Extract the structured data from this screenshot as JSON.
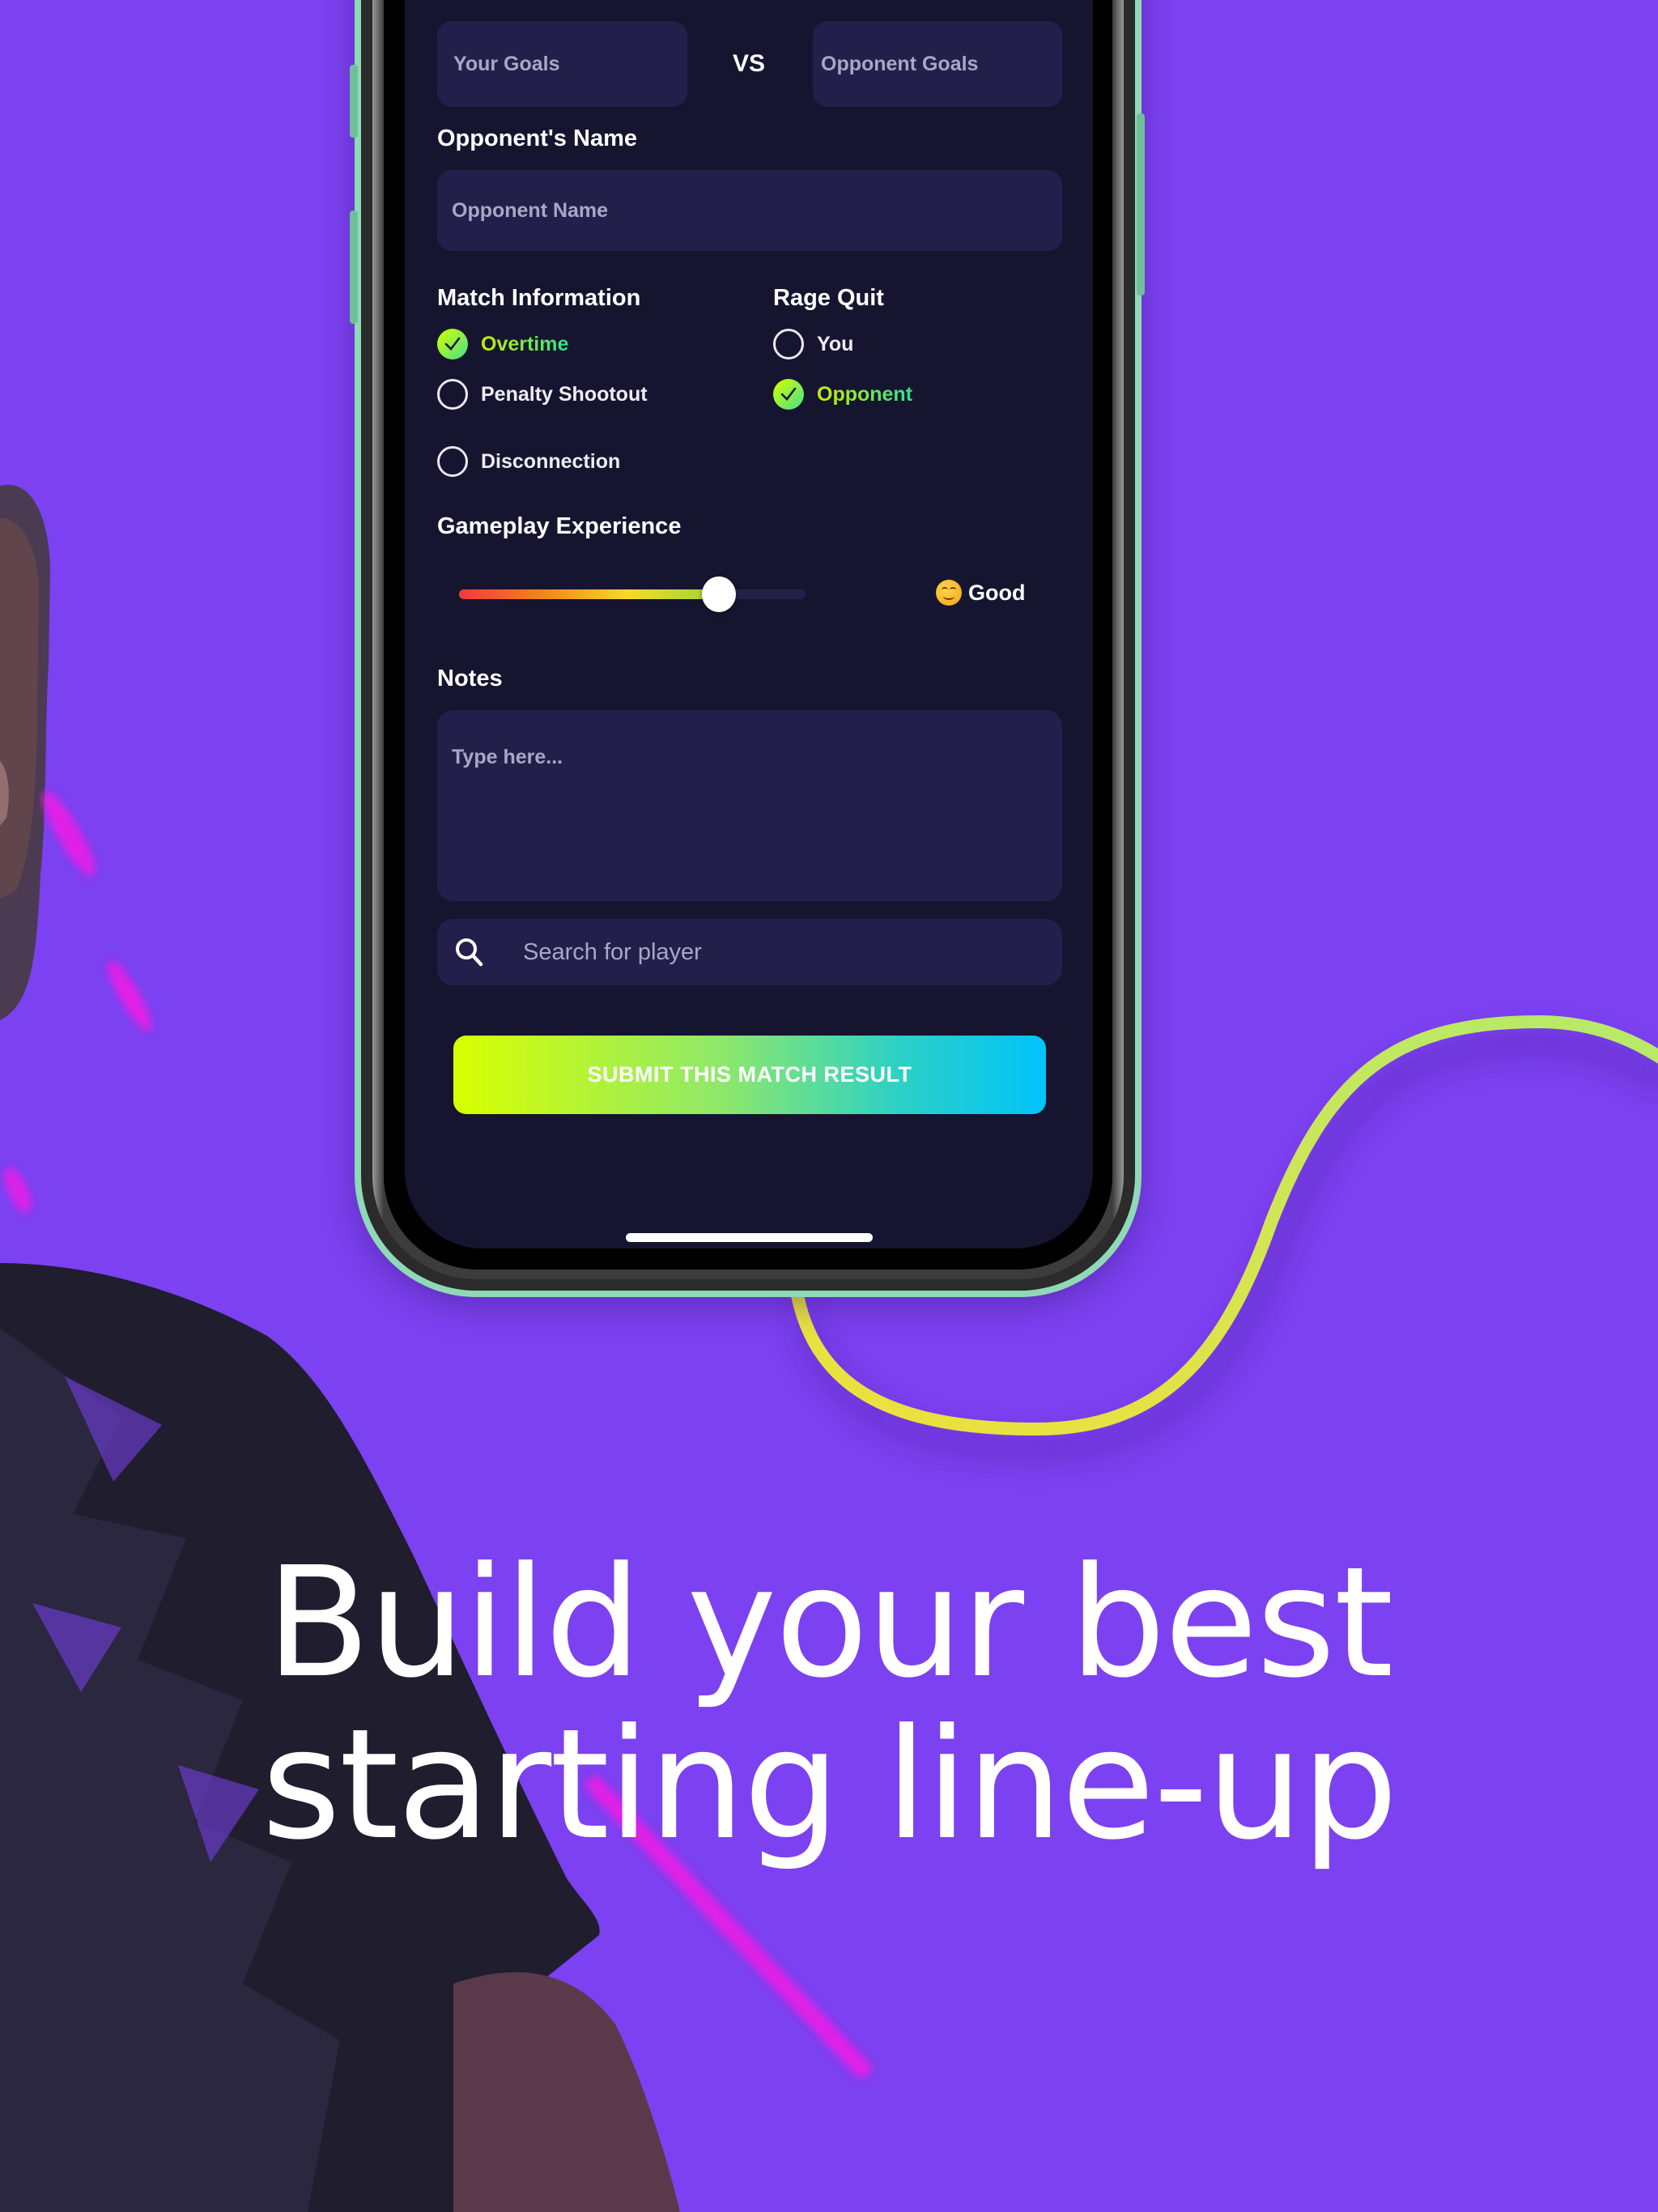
{
  "colors": {
    "background": "#7c41f0",
    "screen_background": "#161530",
    "field_background": "#22204a",
    "accent_start": "#d9ff00",
    "accent_end": "#00c3fa",
    "curve": "#d4ec3c",
    "phone_frame": "#8fd9b6"
  },
  "form": {
    "score": {
      "your_goals_placeholder": "Your Goals",
      "vs_label": "VS",
      "opponent_goals_placeholder": "Opponent Goals"
    },
    "opponent_name": {
      "label": "Opponent's Name",
      "placeholder": "Opponent Name"
    },
    "match_information": {
      "label": "Match Information",
      "options": [
        {
          "label": "Overtime",
          "checked": true
        },
        {
          "label": "Penalty Shootout",
          "checked": false
        },
        {
          "label": "Disconnection",
          "checked": false
        }
      ]
    },
    "rage_quit": {
      "label": "Rage Quit",
      "options": [
        {
          "label": "You",
          "checked": false
        },
        {
          "label": "Opponent",
          "checked": true
        }
      ]
    },
    "gameplay_experience": {
      "label": "Gameplay Experience",
      "value_percent": 75,
      "rating_icon": "smiling-face-icon",
      "rating_label": "Good"
    },
    "notes": {
      "label": "Notes",
      "placeholder": "Type here..."
    },
    "search": {
      "icon": "search-icon",
      "placeholder": "Search for player"
    },
    "submit_label": "SUBMIT THIS MATCH RESULT"
  },
  "headline": {
    "line1": "Build your best",
    "line2": "starting line-up"
  }
}
